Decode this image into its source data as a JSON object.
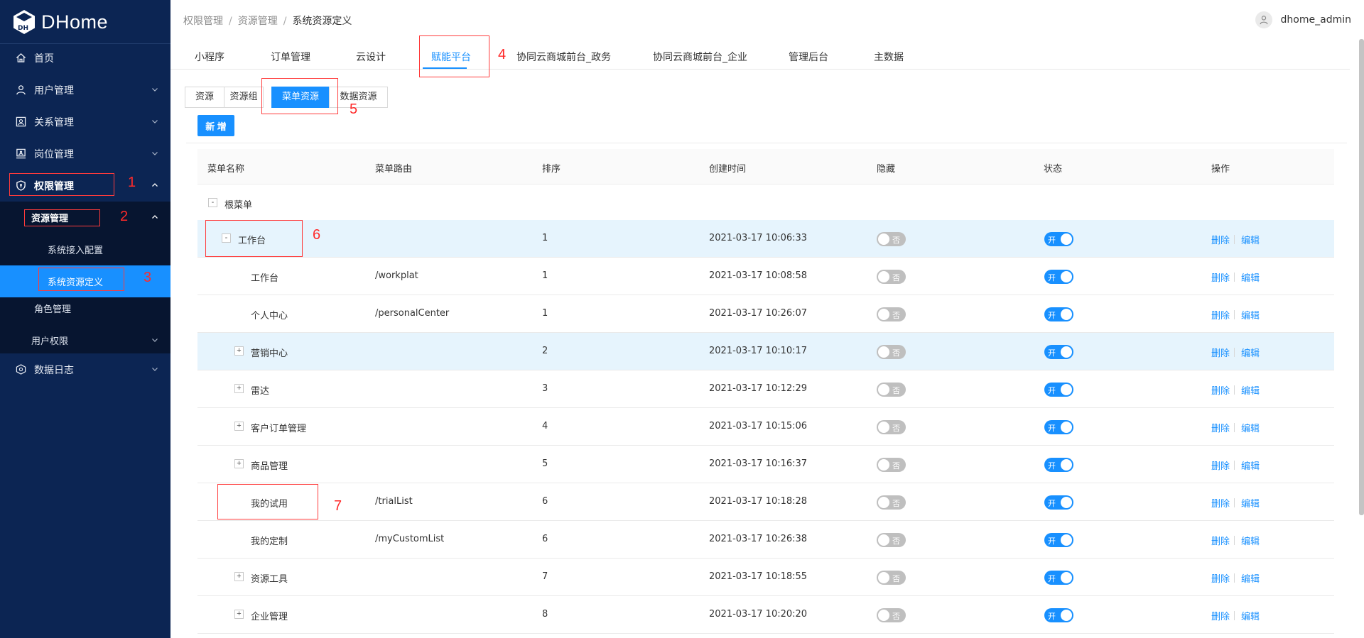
{
  "app": {
    "title": "DHome"
  },
  "sidebar": {
    "items": [
      {
        "label": "首页",
        "icon": "home-icon"
      },
      {
        "label": "用户管理",
        "icon": "user-icon"
      },
      {
        "label": "关系管理",
        "icon": "relation-icon"
      },
      {
        "label": "岗位管理",
        "icon": "position-icon"
      },
      {
        "label": "权限管理",
        "icon": "shield-icon"
      }
    ],
    "sub_group": "资源管理",
    "sub_items": [
      "系统接入配置",
      "系统资源定义"
    ],
    "extra_items": [
      "角色管理",
      "用户权限"
    ],
    "last_item": {
      "label": "数据日志",
      "icon": "data-log-icon"
    }
  },
  "header": {
    "breadcrumb": [
      "权限管理",
      "资源管理",
      "系统资源定义"
    ],
    "user": "dhome_admin"
  },
  "top_tabs": [
    "小程序",
    "订单管理",
    "云设计",
    "赋能平台",
    "协同云商城前台_政务",
    "协同云商城前台_企业",
    "管理后台",
    "主数据"
  ],
  "sub_tabs": [
    "资源",
    "资源组",
    "菜单资源",
    "数据资源"
  ],
  "add_button": "新 增",
  "annotations": [
    "1",
    "2",
    "3",
    "4",
    "5",
    "6",
    "7"
  ],
  "table": {
    "columns": [
      "菜单名称",
      "菜单路由",
      "排序",
      "创建时间",
      "隐藏",
      "状态",
      "操作"
    ],
    "root_label": "根菜单",
    "hide_text": "否",
    "status_text": "开",
    "delete_text": "删除",
    "edit_text": "编辑",
    "rows": [
      {
        "name": "工作台",
        "route": "",
        "order": "1",
        "created": "2021-03-17 10:06:33",
        "expander": "-"
      },
      {
        "name": "工作台",
        "route": "/workplat",
        "order": "1",
        "created": "2021-03-17 10:08:58",
        "expander": ""
      },
      {
        "name": "个人中心",
        "route": "/personalCenter",
        "order": "1",
        "created": "2021-03-17 10:26:07",
        "expander": ""
      },
      {
        "name": "营销中心",
        "route": "",
        "order": "2",
        "created": "2021-03-17 10:10:17",
        "expander": "+"
      },
      {
        "name": "雷达",
        "route": "",
        "order": "3",
        "created": "2021-03-17 10:12:29",
        "expander": "+"
      },
      {
        "name": "客户订单管理",
        "route": "",
        "order": "4",
        "created": "2021-03-17 10:15:06",
        "expander": "+"
      },
      {
        "name": "商品管理",
        "route": "",
        "order": "5",
        "created": "2021-03-17 10:16:37",
        "expander": "+"
      },
      {
        "name": "我的试用",
        "route": "/trialList",
        "order": "6",
        "created": "2021-03-17 10:18:28",
        "expander": ""
      },
      {
        "name": "我的定制",
        "route": "/myCustomList",
        "order": "6",
        "created": "2021-03-17 10:26:38",
        "expander": ""
      },
      {
        "name": "资源工具",
        "route": "",
        "order": "7",
        "created": "2021-03-17 10:18:55",
        "expander": "+"
      },
      {
        "name": "企业管理",
        "route": "",
        "order": "8",
        "created": "2021-03-17 10:20:20",
        "expander": "+"
      }
    ]
  },
  "colors": {
    "sidebar_bg": "#0c2553",
    "accent": "#1890ff",
    "annotation": "#ff2a2a",
    "row_highlight": "#e6f4fd"
  }
}
